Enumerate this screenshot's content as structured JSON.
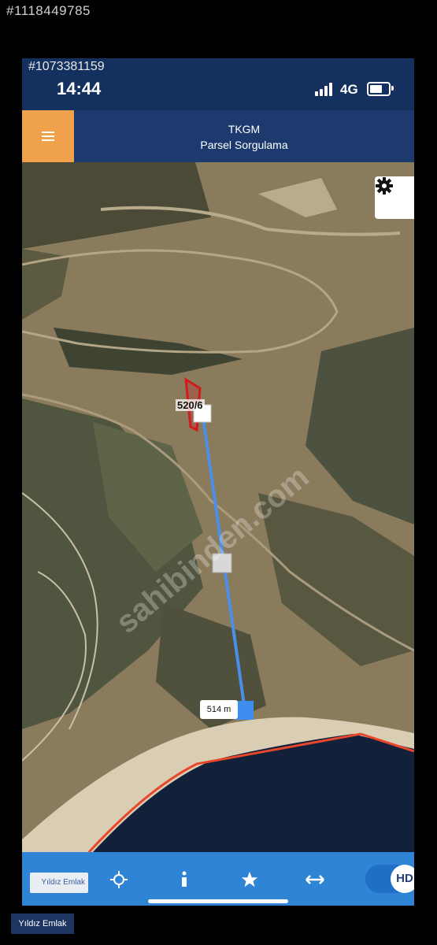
{
  "watermark_top": "#1118449785",
  "status_bar": {
    "listing_id": "#1073381159",
    "time": "14:44",
    "network": "4G"
  },
  "app_bar": {
    "title": "TKGM",
    "subtitle": "Parsel Sorgulama"
  },
  "map": {
    "parcel_label": "520/6",
    "distance_label": "514 m",
    "watermark": "sahibinden.com"
  },
  "bottom_bar": {
    "brand": "Yıldız Emlak",
    "hd_label": "HD",
    "hd_enabled": true,
    "icons": [
      "crosshair-icon",
      "info-icon",
      "star-icon",
      "double-arrow-icon"
    ]
  },
  "watermark_bottom": "Yıldız Emlak",
  "colors": {
    "status_bar": "#13305e",
    "app_bar": "#1c3a6e",
    "menu_button": "#f0a14c",
    "bottom_bar": "#2f84d6",
    "measure_line": "#4a8fe8",
    "parcel_outline": "#d11a1a",
    "coast_line": "#e8472b"
  }
}
